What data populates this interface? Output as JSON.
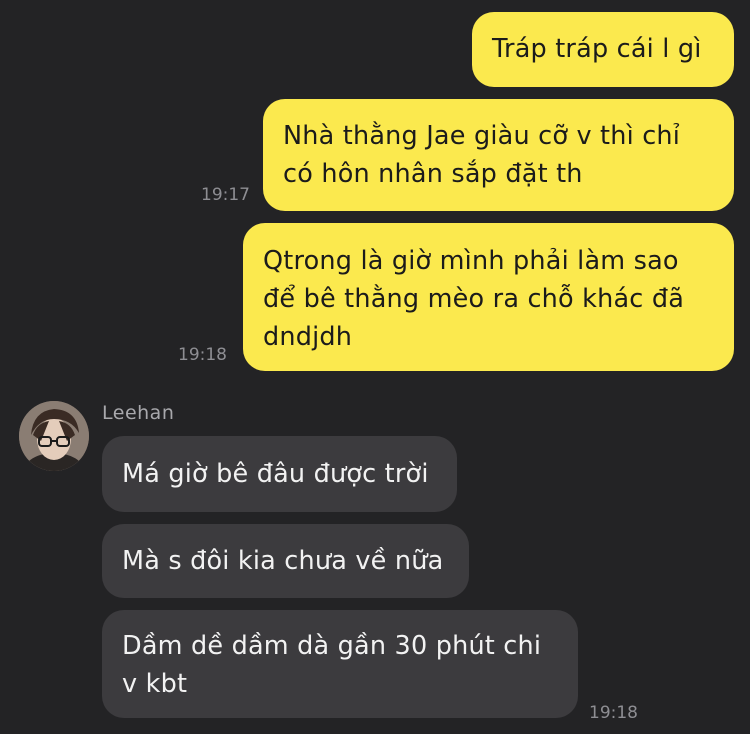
{
  "chat": {
    "outgoing": [
      {
        "text": "Tráp tráp cái l gì",
        "time": ""
      },
      {
        "text": "Nhà thằng Jae giàu cỡ v thì chỉ\ncó hôn nhân sắp đặt th",
        "time": "19:17"
      },
      {
        "text": "Qtrong là giờ mình phải làm sao\nđể bê thằng mèo ra chỗ khác đã\ndndjdh",
        "time": "19:18"
      }
    ],
    "incoming": {
      "sender": "Leehan",
      "avatar_icon": "user-avatar-photo",
      "messages": [
        {
          "text": "Má giờ bê đâu được trời",
          "time": ""
        },
        {
          "text": "Mà s đôi kia chưa về nữa",
          "time": ""
        },
        {
          "text": "Dầm dề dầm dà gần 30 phút chi\nv kbt",
          "time": "19:18"
        }
      ]
    }
  },
  "colors": {
    "background": "#232325",
    "outgoing_bubble": "#fbe94e",
    "incoming_bubble": "#3c3b3e",
    "timestamp": "#8e8e93"
  }
}
